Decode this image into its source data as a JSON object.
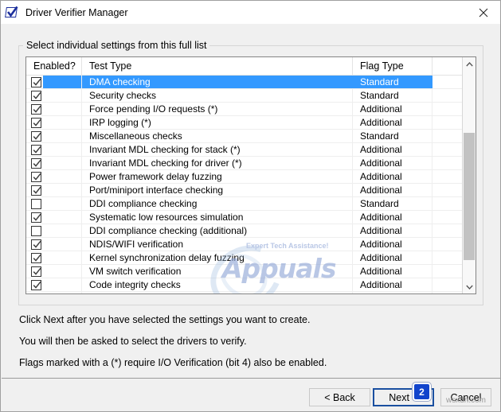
{
  "window": {
    "title": "Driver Verifier Manager",
    "icon": "driver-verifier-icon",
    "close_icon": "close-icon"
  },
  "groupbox": {
    "label": "Select individual settings from this full list"
  },
  "listview": {
    "columns": [
      "Enabled?",
      "Test Type",
      "Flag Type",
      ""
    ],
    "rows": [
      {
        "enabled": true,
        "test": "DMA checking",
        "flag": "Standard",
        "selected": true
      },
      {
        "enabled": true,
        "test": "Security checks",
        "flag": "Standard",
        "selected": false
      },
      {
        "enabled": true,
        "test": "Force pending I/O requests (*)",
        "flag": "Additional",
        "selected": false
      },
      {
        "enabled": true,
        "test": "IRP logging (*)",
        "flag": "Additional",
        "selected": false
      },
      {
        "enabled": true,
        "test": "Miscellaneous checks",
        "flag": "Standard",
        "selected": false
      },
      {
        "enabled": true,
        "test": "Invariant MDL checking for stack (*)",
        "flag": "Additional",
        "selected": false
      },
      {
        "enabled": true,
        "test": "Invariant MDL checking for driver (*)",
        "flag": "Additional",
        "selected": false
      },
      {
        "enabled": true,
        "test": "Power framework delay fuzzing",
        "flag": "Additional",
        "selected": false
      },
      {
        "enabled": true,
        "test": "Port/miniport interface checking",
        "flag": "Additional",
        "selected": false
      },
      {
        "enabled": false,
        "test": "DDI compliance checking",
        "flag": "Standard",
        "selected": false
      },
      {
        "enabled": true,
        "test": "Systematic low resources simulation",
        "flag": "Additional",
        "selected": false
      },
      {
        "enabled": false,
        "test": "DDI compliance checking (additional)",
        "flag": "Additional",
        "selected": false
      },
      {
        "enabled": true,
        "test": "NDIS/WIFI verification",
        "flag": "Additional",
        "selected": false
      },
      {
        "enabled": true,
        "test": "Kernel synchronization delay fuzzing",
        "flag": "Additional",
        "selected": false
      },
      {
        "enabled": true,
        "test": "VM switch verification",
        "flag": "Additional",
        "selected": false
      },
      {
        "enabled": true,
        "test": "Code integrity checks",
        "flag": "Additional",
        "selected": false
      }
    ],
    "scrollbar": {
      "up_icon": "chevron-up-icon",
      "down_icon": "chevron-down-icon"
    }
  },
  "instructions": [
    "Click Next after you have selected the settings you want to create.",
    "You will then be asked to select the drivers to verify.",
    "Flags marked with a (*) require I/O Verification (bit 4) also be enabled."
  ],
  "footer": {
    "back_label": "< Back",
    "next_label": "Next >",
    "cancel_label": "Cancel"
  },
  "annotation": {
    "badge_number": "2"
  },
  "watermarks": {
    "list_brand": "Appuals",
    "list_tagline": "Expert Tech Assistance!",
    "site": "wsxdn.com"
  },
  "colors": {
    "selection": "#3399ff",
    "accent": "#1a4fa0",
    "badge": "#1144cc",
    "window_bg": "#f0f0f0"
  }
}
